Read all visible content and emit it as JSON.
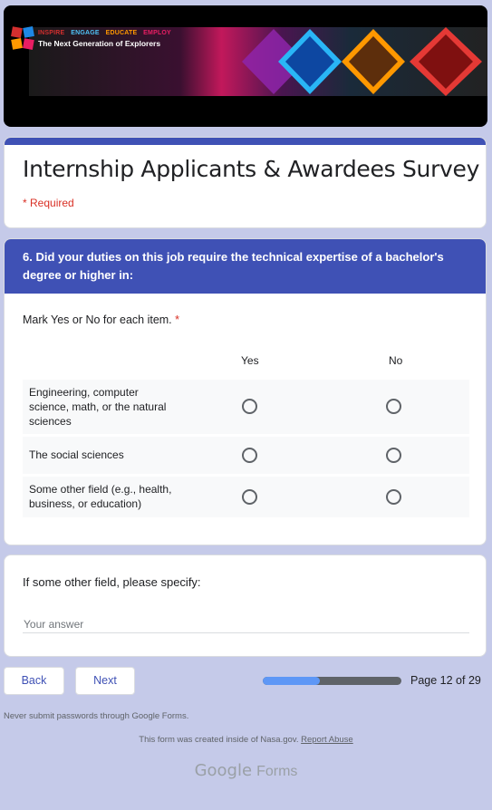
{
  "banner": {
    "tagline_words": [
      "INSPIRE",
      "ENGAGE",
      "EDUCATE",
      "EMPLOY"
    ],
    "subtitle": "The Next Generation of Explorers"
  },
  "form": {
    "title": "Internship Applicants & Awardees Survey",
    "required_note": "* Required"
  },
  "question": {
    "text": "6. Did your duties on this job require the technical expertise of a bachelor's degree or higher in:",
    "instruction": "Mark Yes or No for each item.",
    "required_mark": "*",
    "columns": [
      "Yes",
      "No"
    ],
    "rows": [
      {
        "label": "Engineering, computer science, math, or the natural sciences"
      },
      {
        "label": "The social sciences"
      },
      {
        "label": "Some other field (e.g., health, business, or education)"
      }
    ]
  },
  "other": {
    "question": "If some other field, please specify:",
    "placeholder": "Your answer"
  },
  "nav": {
    "back_label": "Back",
    "next_label": "Next",
    "page_text": "Page 12 of 29",
    "progress_fraction": 0.414
  },
  "footer": {
    "warning": "Never submit passwords through Google Forms.",
    "created_prefix": "This form was created inside of Nasa.gov.",
    "report_abuse": "Report Abuse",
    "brand_google": "Google",
    "brand_forms": "Forms"
  },
  "colors": {
    "accent": "#3f51b5",
    "background": "#c5cae9",
    "required": "#d93025",
    "progress": "#5e97f6"
  }
}
